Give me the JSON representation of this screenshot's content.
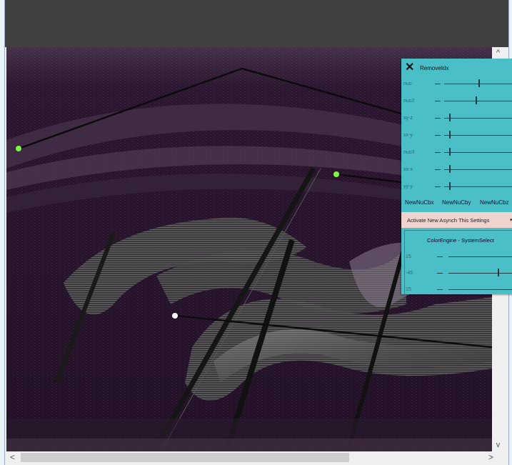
{
  "panel": {
    "remove_label": "RemoveIdx",
    "sliders": [
      {
        "label": "nuo",
        "value": 0.48
      },
      {
        "label": "nuo2",
        "value": 0.44
      },
      {
        "label": "xy-z",
        "value": 0.03
      },
      {
        "label": "xx-y",
        "value": 0.03
      },
      {
        "label": "nuo3",
        "value": 0.03
      },
      {
        "label": "xx-x",
        "value": 0.03
      },
      {
        "label": "yy-y",
        "value": 0.03
      }
    ],
    "nub_buttons": [
      "NewNuCbx",
      "NewNuCby",
      "NewNuCbz"
    ],
    "activate_label": "Activate New Asynch This Settings",
    "color_engine_label": "ColorEngine - SystemSelect",
    "color_sliders": [
      {
        "label": "15",
        "value": 0.0
      },
      {
        "label": "-45",
        "value": 0.72
      },
      {
        "label": "15",
        "value": 0.0
      }
    ]
  },
  "scroll": {
    "up": "^",
    "down": "v",
    "left": "<",
    "right": ">"
  },
  "colors": {
    "panel_bg": "#4bbfc7",
    "activate_bg": "#f0d2cf",
    "control_point": "#7cff3a"
  }
}
